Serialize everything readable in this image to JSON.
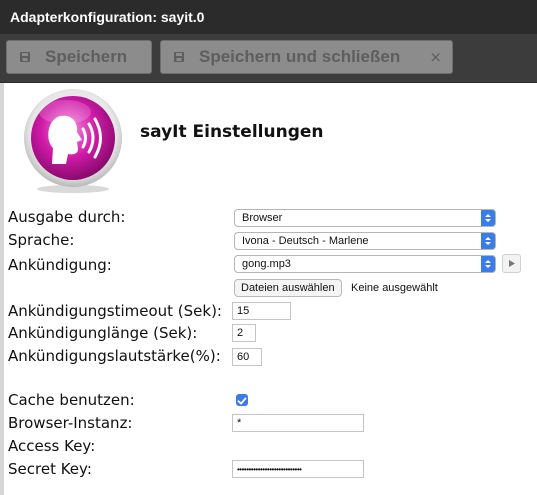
{
  "window": {
    "title": "Adapterkonfiguration: sayit.0"
  },
  "toolbar": {
    "save_label": "Speichern",
    "save_close_label": "Speichern und schließen",
    "close_symbol": "×"
  },
  "header": {
    "title": "sayIt Einstellungen",
    "logo_icon": "speaking-head-icon"
  },
  "form": {
    "output_label": "Ausgabe durch:",
    "output_value": "Browser",
    "language_label": "Sprache:",
    "language_value": "Ivona - Deutsch - Marlene",
    "announce_label": "Ankündigung:",
    "announce_value": "gong.mp3",
    "file_button_label": "Dateien auswählen",
    "file_status": "Keine ausgewählt",
    "timeout_label": "Ankündigungstimeout (Sek):",
    "timeout_value": "15",
    "length_label": "Ankündigunglänge (Sek):",
    "length_value": "2",
    "volume_label": "Ankündigungslautstärke(%):",
    "volume_value": "60",
    "cache_label": "Cache benutzen:",
    "cache_checked": true,
    "browser_label": "Browser-Instanz:",
    "browser_value": "*",
    "access_label": "Access Key:",
    "access_value": "",
    "secret_label": "Secret Key:",
    "secret_value": "••••••••••••••••••••••••••••"
  },
  "colors": {
    "titlebar": "#2b2b2b",
    "toolbar": "#3c3c3c",
    "select_arrow": "#3a7de8",
    "logo_magenta": "#d01aa8"
  }
}
